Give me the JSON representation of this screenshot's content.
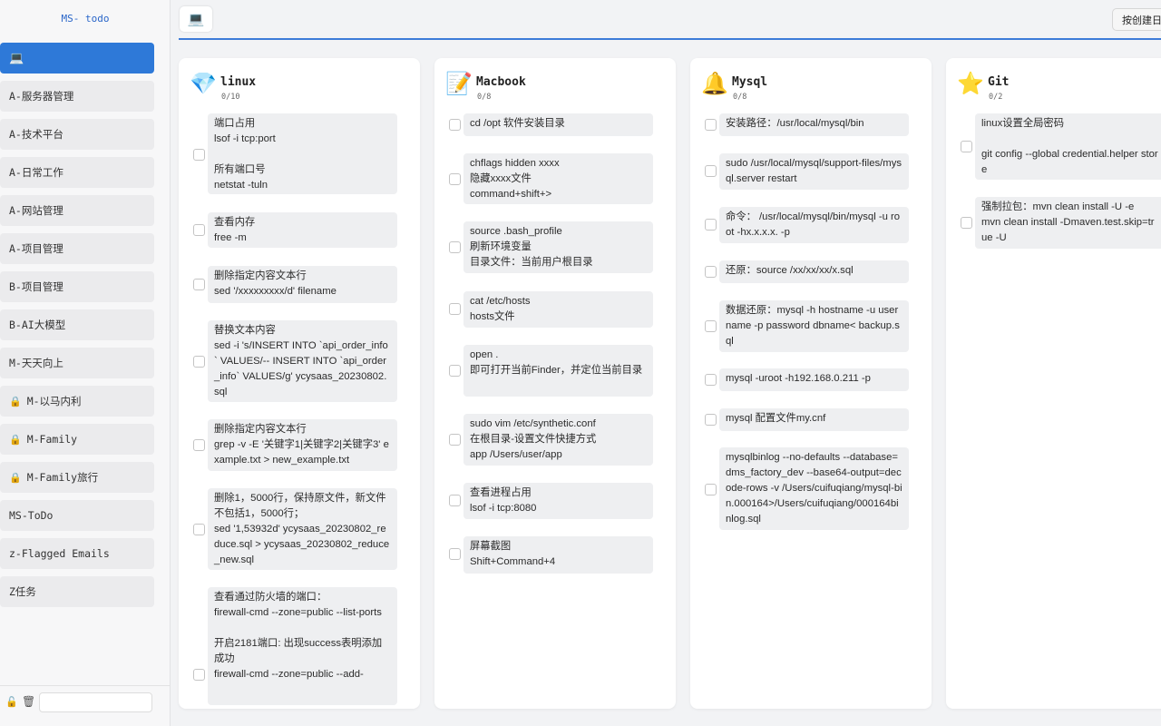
{
  "app": {
    "title": "MS- todo"
  },
  "sidebar": {
    "items": [
      {
        "label": "",
        "icon": "laptop-icon",
        "active": true,
        "locked": false
      },
      {
        "label": "A-服务器管理",
        "locked": false
      },
      {
        "label": "A-技术平台",
        "locked": false
      },
      {
        "label": "A-日常工作",
        "locked": false
      },
      {
        "label": "A-网站管理",
        "locked": false
      },
      {
        "label": "A-项目管理",
        "locked": false
      },
      {
        "label": "B-项目管理",
        "locked": false
      },
      {
        "label": "B-AI大模型",
        "locked": false
      },
      {
        "label": "M-天天向上",
        "locked": false
      },
      {
        "label": "M-以马内利",
        "locked": true
      },
      {
        "label": "M-Family",
        "locked": true
      },
      {
        "label": "M-Family旅行",
        "locked": true
      },
      {
        "label": "MS-ToDo",
        "locked": false
      },
      {
        "label": "z-Flagged Emails",
        "locked": false
      },
      {
        "label": "Z任务",
        "locked": false
      }
    ],
    "new_list_placeholder": ""
  },
  "header": {
    "sort_label": "按创建日"
  },
  "columns": [
    {
      "title": "linux",
      "icon": "gem-icon",
      "count": "0/10",
      "tasks": [
        "端口占用\nlsof -i tcp:port\n\n所有端口号\nnetstat -tuln",
        "查看内存\nfree -m",
        "删除指定内容文本行\nsed '/xxxxxxxxx/d' filename",
        "替换文本内容\nsed -i 's/INSERT INTO `api_order_info` VALUES/-- INSERT INTO `api_order_info` VALUES/g' ycysaas_20230802.sql",
        "删除指定内容文本行\ngrep -v -E '关键字1|关键字2|关键字3' example.txt > new_example.txt",
        "删除1，5000行，保持原文件，新文件不包括1，5000行；\nsed '1,53932d' ycysaas_20230802_reduce.sql > ycysaas_20230802_reduce_new.sql",
        "查看通过防火墙的端口：\nfirewall-cmd --zone=public --list-ports\n\n开启2181端口: 出现success表明添加成功\nfirewall-cmd --zone=public --add-"
      ]
    },
    {
      "title": "Macbook",
      "icon": "memo-icon",
      "count": "0/8",
      "tasks": [
        "cd /opt 软件安装目录",
        "chflags hidden xxxx\n隐藏xxxx文件\ncommand+shift+>",
        "source .bash_profile\n刷新环境变量\n目录文件：当前用户根目录",
        "cat /etc/hosts\nhosts文件",
        "open .\n即可打开当前Finder，并定位当前目录",
        "sudo vim /etc/synthetic.conf\n在根目录-设置文件快捷方式\napp /Users/user/app",
        "查看进程占用\nlsof -i tcp:8080",
        "屏幕截图\nShift+Command+4"
      ]
    },
    {
      "title": "Mysql",
      "icon": "bell-icon",
      "count": "0/8",
      "tasks": [
        "安装路径：/usr/local/mysql/bin",
        "sudo /usr/local/mysql/support-files/mysql.server restart",
        "命令： /usr/local/mysql/bin/mysql -u root -hx.x.x.x. -p",
        "还原：source /xx/xx/xx/x.sql",
        "数据还原：mysql -h hostname -u username -p password dbname< backup.sql",
        "mysql -uroot -h192.168.0.211 -p",
        "mysql 配置文件my.cnf",
        "mysqlbinlog --no-defaults --database=dms_factory_dev --base64-output=decode-rows -v /Users/cuifuqiang/mysql-bin.000164>/Users/cuifuqiang/000164binlog.sql"
      ]
    },
    {
      "title": "Git",
      "icon": "star-icon",
      "count": "0/2",
      "tasks": [
        "linux设置全局密码\n\ngit config --global credential.helper store",
        "强制拉包：mvn clean install -U -e\nmvn clean install -Dmaven.test.skip=true -U"
      ]
    }
  ]
}
